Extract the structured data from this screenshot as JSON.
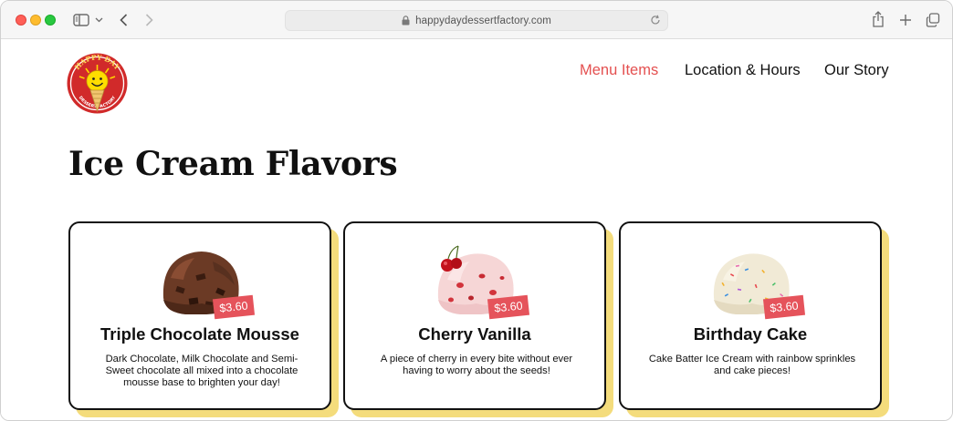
{
  "browser": {
    "url": "happydaydessertfactory.com"
  },
  "logo": {
    "top_text": "HAPPY DAY",
    "bottom_text": "DESSERT FACTORY"
  },
  "nav": {
    "items": [
      {
        "label": "Menu Items",
        "active": true
      },
      {
        "label": "Location & Hours",
        "active": false
      },
      {
        "label": "Our Story",
        "active": false
      }
    ]
  },
  "page": {
    "title": "Ice Cream Flavors"
  },
  "flavors": [
    {
      "name": "Triple Chocolate Mousse",
      "price": "$3.60",
      "description": "Dark Chocolate, Milk Chocolate and Semi-Sweet chocolate all mixed into a chocolate mousse base to brighten your day!"
    },
    {
      "name": "Cherry Vanilla",
      "price": "$3.60",
      "description": "A piece of cherry in every bite without ever having to worry about the seeds!"
    },
    {
      "name": "Birthday Cake",
      "price": "$3.60",
      "description": "Cake Batter Ice Cream with rainbow sprinkles and cake pieces!"
    }
  ],
  "colors": {
    "accent": "#e45050",
    "price_tag": "#e5535b",
    "card_shadow": "#f4dc7c"
  }
}
